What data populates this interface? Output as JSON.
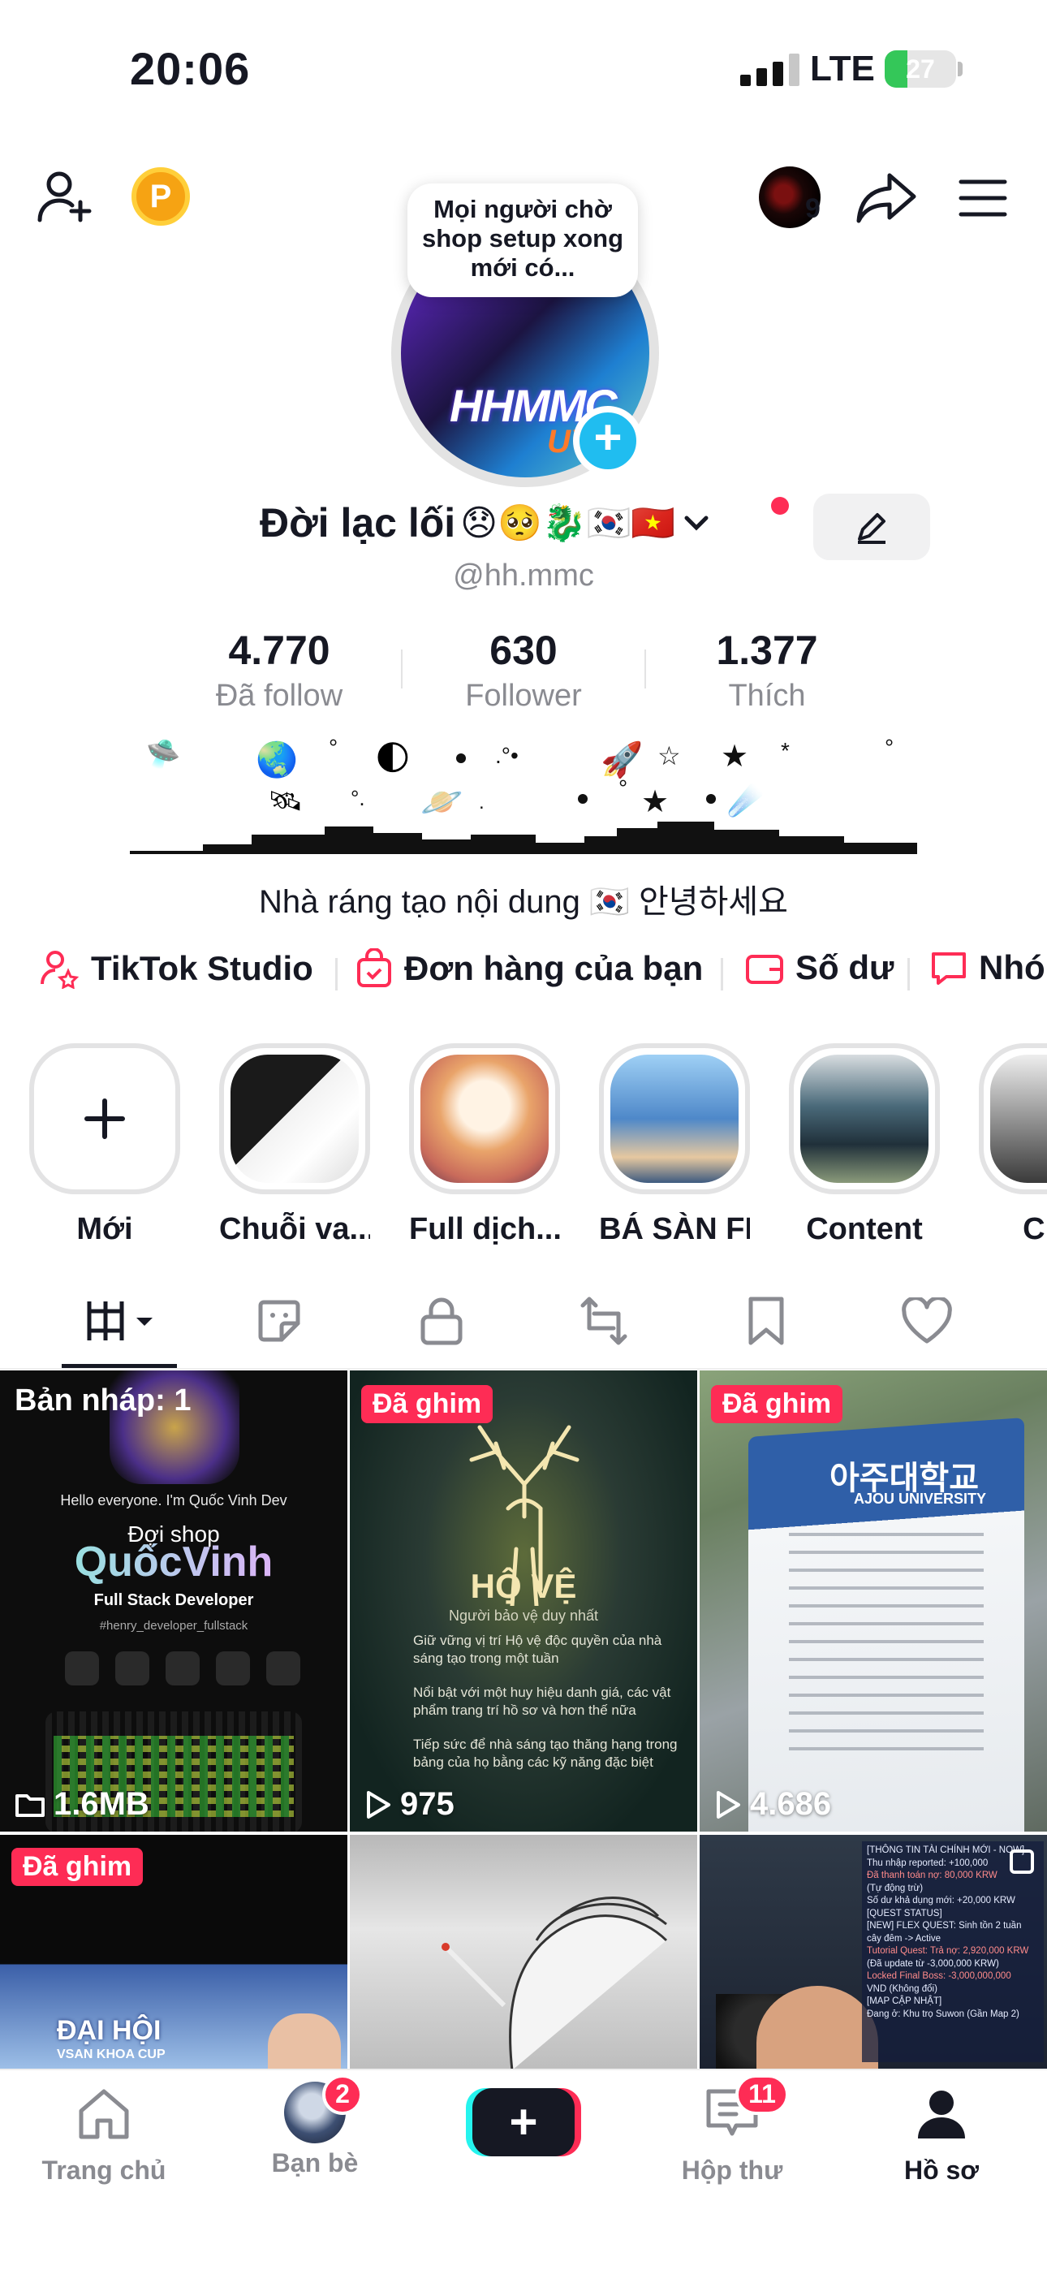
{
  "status_bar": {
    "time": "20:06",
    "network": "LTE",
    "battery": "27"
  },
  "header": {
    "coin_label": "P",
    "notif_count": "9"
  },
  "profile": {
    "tooltip": "Mọi người chờ shop setup xong mới có...",
    "avatar_text": "HHMMC",
    "avatar_sub": "UY",
    "name": "Đời lạc lối",
    "name_emojis": "😞🥺🐉🇰🇷🇻🇳",
    "handle": "@hh.mmc",
    "stats": [
      {
        "value": "4.770",
        "label": "Đã follow"
      },
      {
        "value": "630",
        "label": "Follower"
      },
      {
        "value": "1.377",
        "label": "Thích"
      }
    ],
    "bio": "Nhà ráng tạo nội dung 🇰🇷 안녕하세요"
  },
  "links": [
    {
      "label": "TikTok Studio",
      "icon": "person-star-icon"
    },
    {
      "label": "Đơn hàng của bạn",
      "icon": "shopping-bag-icon"
    },
    {
      "label": "Số dư",
      "icon": "wallet-icon"
    },
    {
      "label": "Nhó",
      "icon": "chat-icon"
    }
  ],
  "highlights": [
    {
      "label": "Mới",
      "color": "#ffffff"
    },
    {
      "label": "Chuỗi va...",
      "color": "#2b2b2b"
    },
    {
      "label": "Full dịch...",
      "color": "#e9a46a"
    },
    {
      "label": "BÁ SÀN FF",
      "color": "#4e88c9"
    },
    {
      "label": "Content",
      "color": "#4a6a7a"
    },
    {
      "label": "Chợ",
      "color": "#3a3a3a"
    }
  ],
  "grid": [
    {
      "badge": "Bản nháp: 1",
      "badge_type": "draft",
      "stat": "1.6MB",
      "stat_icon": "folder-icon",
      "title": "QuốcVinh",
      "subtitle": "Full Stack Developer",
      "line1": "Hello everyone. I'm Quốc Vinh Dev",
      "line2": "Đợi shop",
      "line3": "#henry_developer_fullstack",
      "bg": "#0d0d0d"
    },
    {
      "badge": "Đã ghim",
      "badge_type": "pin",
      "stat": "975",
      "stat_icon": "play-icon",
      "title": "HỘ VỆ",
      "subtitle": "Người bảo vệ duy nhất",
      "line1": "Giữ vững vị trí Hộ vệ độc quyền của nhà sáng tạo trong một tuần",
      "line2": "Nổi bật với một huy hiệu danh giá, các vật phẩm trang trí hồ sơ và hơn thế nữa",
      "line3": "Tiếp sức để nhà sáng tạo thăng hạng trong bảng của họ bằng các kỹ năng đặc biệt",
      "bg": "#1c2e2a"
    },
    {
      "badge": "Đã ghim",
      "badge_type": "pin",
      "stat": "4.686",
      "stat_icon": "play-icon",
      "title": "아주대학교",
      "subtitle": "AJOU UNIVERSITY",
      "bg": "#7a8aa0"
    },
    {
      "badge": "Đã ghim",
      "badge_type": "pin",
      "title": "ĐẠI HỘI",
      "subtitle": "VSAN KHOA CUP",
      "bg": "#101010"
    },
    {
      "bg": "#cfcfcf"
    },
    {
      "title": "[THÔNG TIN TÀI CHÍNH MỚI - NOW]",
      "lines": [
        "Thu nhập reported: +100,000",
        "Đã thanh toán nợ: 80,000 KRW",
        "(Tự động trừ)",
        "Số dư khả dụng mới: +20,000 KRW",
        "[QUEST STATUS]",
        "[NEW] FLEX QUEST: Sinh tồn 2 tuần",
        "cây đêm -> Active",
        "Tutorial Quest: Trả nợ: 2,920,000 KRW",
        "(Đã update từ -3,000,000 KRW)",
        "Locked Final Boss: -3,000,000,000",
        "VND (Không đổi)",
        "[MAP CẬP NHẬT]",
        "Đang ở: Khu trọ Suwon (Gần Map 2)"
      ],
      "bg": "#2a3441"
    }
  ],
  "nav": [
    {
      "label": "Trang chủ",
      "icon": "home-icon"
    },
    {
      "label": "Bạn bè",
      "icon": "friends-avatar-icon",
      "badge": "2"
    },
    {
      "label": "",
      "icon": "plus-icon"
    },
    {
      "label": "Hộp thư",
      "icon": "inbox-icon",
      "badge": "11"
    },
    {
      "label": "Hồ sơ",
      "icon": "profile-icon"
    }
  ]
}
